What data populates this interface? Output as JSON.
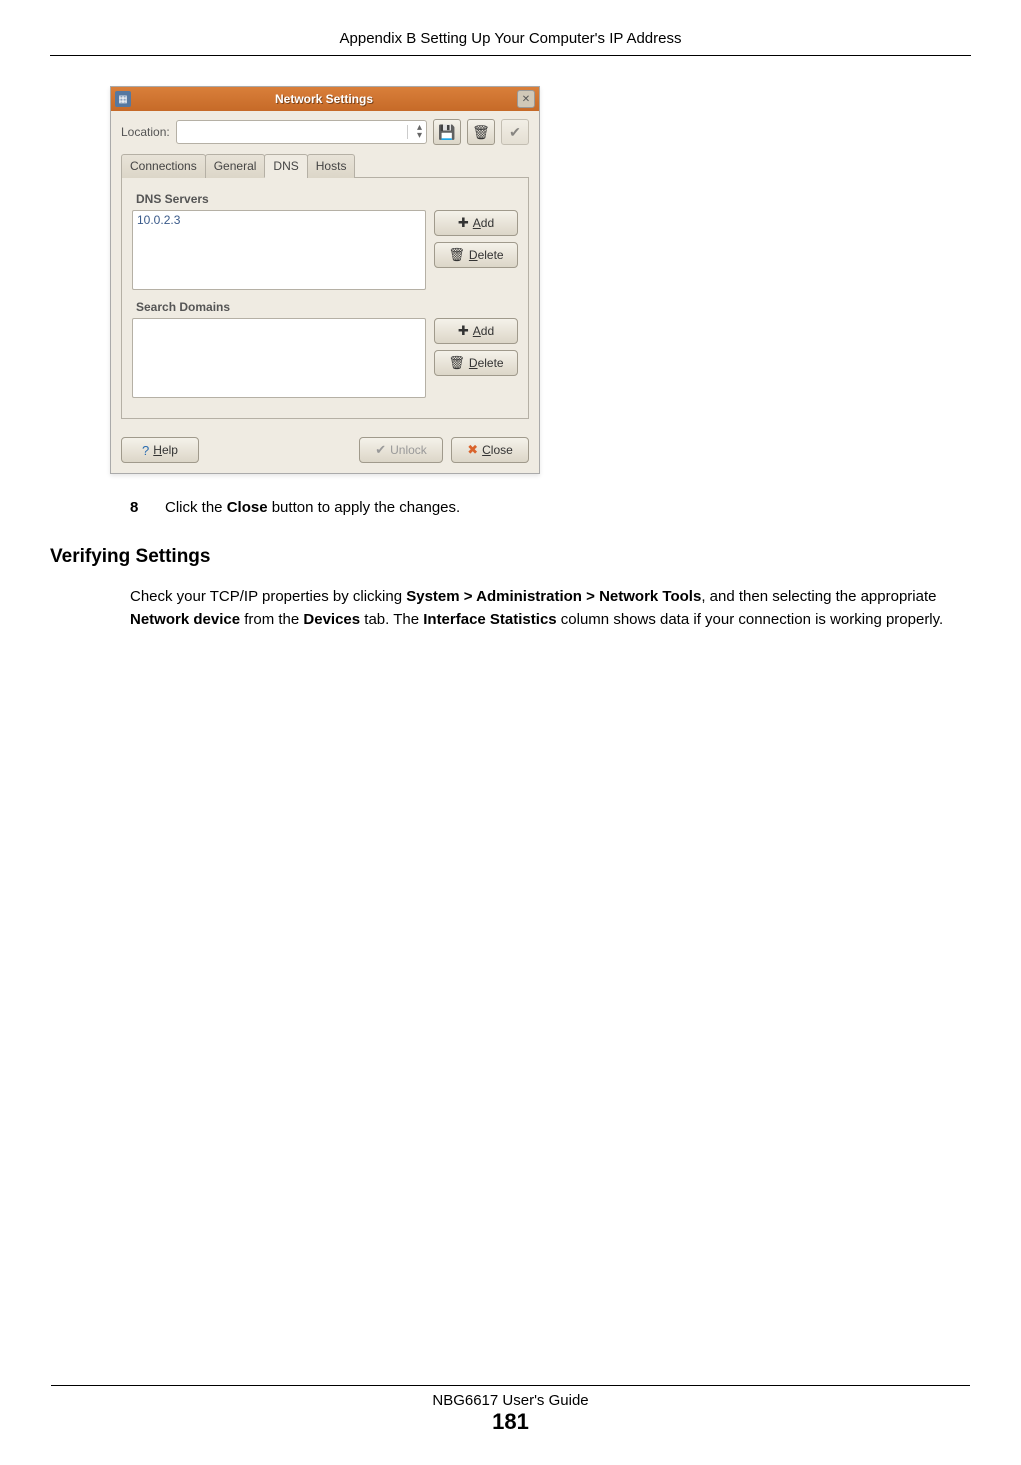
{
  "page_header": "Appendix B Setting Up Your Computer's IP Address",
  "dialog": {
    "title": "Network Settings",
    "location_label": "Location:",
    "tabs": [
      "Connections",
      "General",
      "DNS",
      "Hosts"
    ],
    "active_tab_index": 2,
    "dns_group": "DNS Servers",
    "dns_entry": "10.0.2.3",
    "search_group": "Search Domains",
    "btn_add": "Add",
    "btn_delete": "Delete",
    "btn_help": "Help",
    "btn_unlock": "Unlock",
    "btn_close": "Close"
  },
  "step": {
    "num": "8",
    "text_pre": "Click the ",
    "text_bold": "Close",
    "text_post": " button to apply the changes."
  },
  "section_heading": "Verifying Settings",
  "paragraph": {
    "p1": "Check your TCP/IP properties by clicking ",
    "b1": "System > Administration > Network Tools",
    "p2": ", and then selecting the appropriate ",
    "b2": "Network device",
    "p3": " from the ",
    "b3": "Devices",
    "p4": " tab. The ",
    "b4": "Interface Statistics",
    "p5": " column shows data if your connection is working properly."
  },
  "footer_text": "NBG6617 User's Guide",
  "page_number": "181"
}
